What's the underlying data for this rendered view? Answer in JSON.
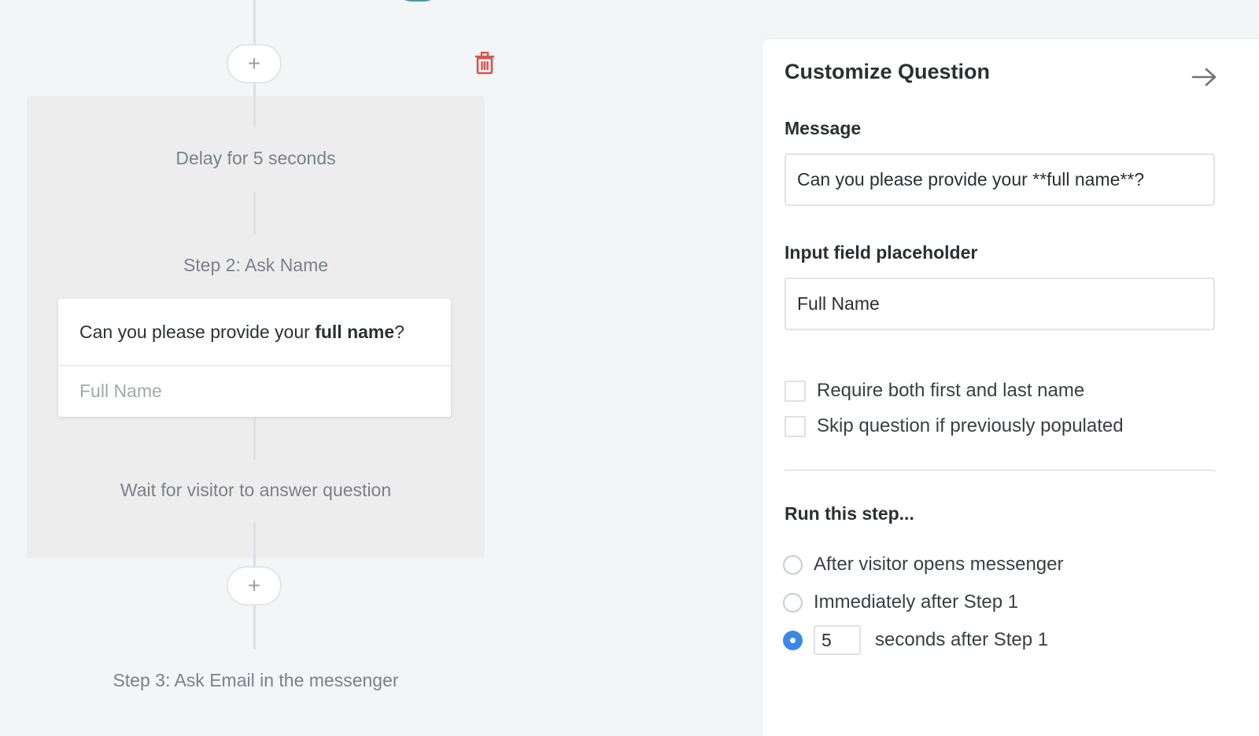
{
  "flow": {
    "add_step_label": "+",
    "delay_label": "Delay for 5 seconds",
    "step2_title": "Step 2: Ask Name",
    "card": {
      "message_prefix": "Can you please provide your ",
      "message_bold": "full name",
      "message_suffix": "?",
      "input_placeholder": "Full Name"
    },
    "wait_label": "Wait for visitor to answer question",
    "step3_title": "Step 3: Ask Email in the messenger"
  },
  "panel": {
    "title": "Customize Question",
    "message_label": "Message",
    "message_value": "Can you please provide your **full name**?",
    "placeholder_label": "Input field placeholder",
    "placeholder_value": "Full Name",
    "checkboxes": [
      {
        "label": "Require both first and last name",
        "checked": false
      },
      {
        "label": "Skip question if previously populated",
        "checked": false
      }
    ],
    "run_label": "Run this step...",
    "radios": [
      {
        "label": "After visitor opens messenger",
        "checked": false
      },
      {
        "label": "Immediately after Step 1",
        "checked": false
      },
      {
        "label": "seconds after Step 1",
        "checked": true
      }
    ],
    "seconds_value": "5"
  },
  "colors": {
    "accent": "#3d87e8",
    "trash": "#d9534f",
    "connector": "#dcdfe3"
  },
  "icons": {
    "trash": "trash-icon",
    "close": "arrow-right-icon",
    "add": "plus-icon"
  }
}
